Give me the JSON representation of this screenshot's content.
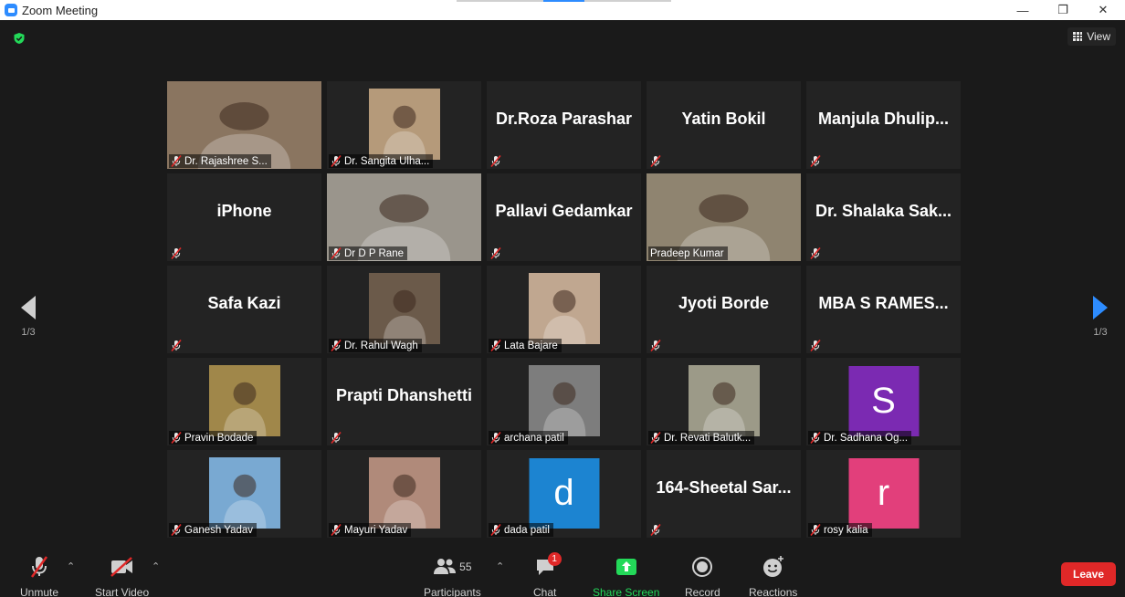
{
  "window": {
    "title": "Zoom Meeting"
  },
  "header": {
    "view_label": "View"
  },
  "pager": {
    "left_page": "1/3",
    "right_page": "1/3"
  },
  "tiles": [
    {
      "name": "Dr. Rajashree S...",
      "type": "video",
      "bg": "#8a7560"
    },
    {
      "name": "Dr. Sangita Ulha...",
      "type": "video",
      "bg": "#b59a7a"
    },
    {
      "name": "Dr.Roza Parashar",
      "type": "name"
    },
    {
      "name": "Yatin Bokil",
      "type": "name"
    },
    {
      "name": "Manjula Dhulip...",
      "type": "name"
    },
    {
      "name": "iPhone",
      "type": "name"
    },
    {
      "name": "Dr D P Rane",
      "type": "video",
      "bg": "#9a958c"
    },
    {
      "name": "Pallavi Gedamkar",
      "type": "name"
    },
    {
      "name": "Pradeep Kumar",
      "type": "video",
      "bg": "#8f8470",
      "active": true
    },
    {
      "name": "Dr. Shalaka Sak...",
      "type": "name"
    },
    {
      "name": "Safa Kazi",
      "type": "name"
    },
    {
      "name": "Dr. Rahul Wagh",
      "type": "video",
      "bg": "#6b5a4a"
    },
    {
      "name": "Lata Bajare",
      "type": "video",
      "bg": "#c0a790"
    },
    {
      "name": "Jyoti Borde",
      "type": "name"
    },
    {
      "name": "MBA S RAMES...",
      "type": "name"
    },
    {
      "name": "Pravin Bodade",
      "type": "video",
      "bg": "#a0874a"
    },
    {
      "name": "Prapti Dhanshetti",
      "type": "name"
    },
    {
      "name": "archana patil",
      "type": "video",
      "bg": "#7d7d7d"
    },
    {
      "name": "Dr. Revati Balutk...",
      "type": "video",
      "bg": "#9c9a88"
    },
    {
      "name": "Dr. Sadhana Og...",
      "type": "letter",
      "letter": "S",
      "bg": "#7b2ab2"
    },
    {
      "name": "Ganesh Yadav",
      "type": "video",
      "bg": "#79a9d2"
    },
    {
      "name": "Mayuri Yadav",
      "type": "video",
      "bg": "#b08a7a"
    },
    {
      "name": "dada patil",
      "type": "letter",
      "letter": "d",
      "bg": "#1c84d1"
    },
    {
      "name": "164-Sheetal  Sar...",
      "type": "name"
    },
    {
      "name": "rosy kalia",
      "type": "letter",
      "letter": "r",
      "bg": "#e23f7b"
    }
  ],
  "toolbar": {
    "unmute_label": "Unmute",
    "start_video_label": "Start Video",
    "participants_label": "Participants",
    "participants_count": "55",
    "chat_label": "Chat",
    "chat_badge": "1",
    "share_label": "Share Screen",
    "record_label": "Record",
    "reactions_label": "Reactions",
    "leave_label": "Leave"
  },
  "colors": {
    "accent": "#2d8cff",
    "leave": "#e02828",
    "share": "#23d959",
    "active_speaker": "#d9e67a"
  }
}
